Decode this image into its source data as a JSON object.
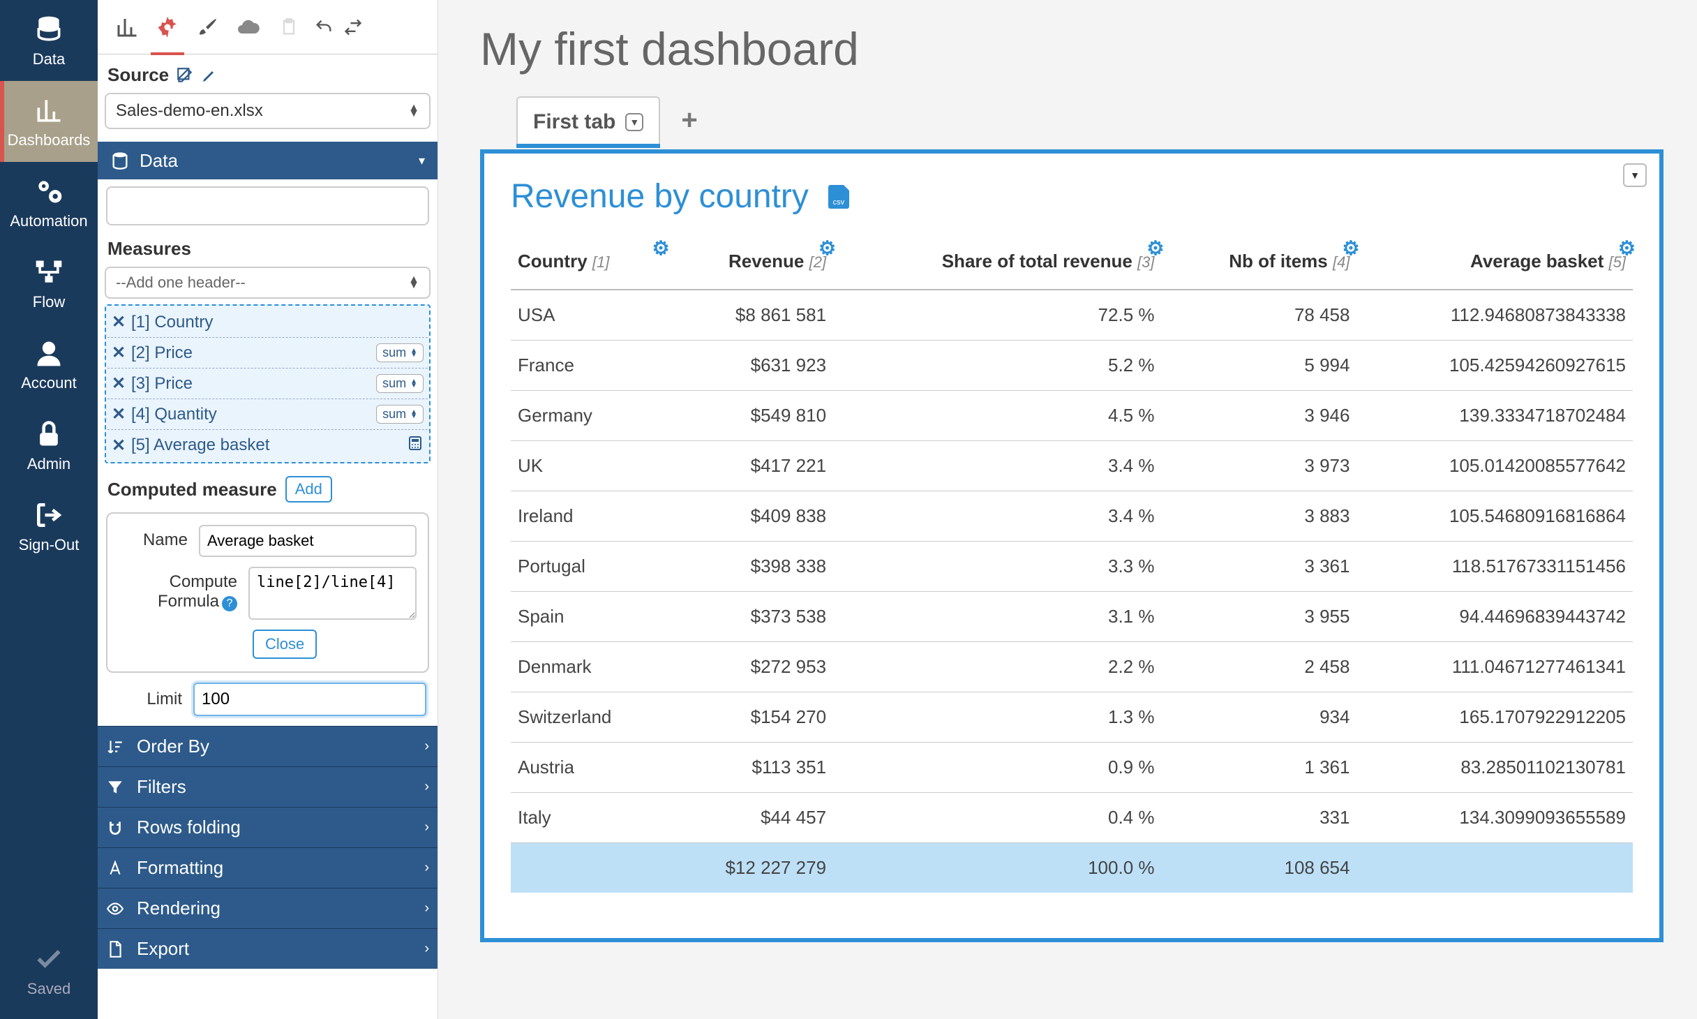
{
  "sidenav": {
    "items": [
      {
        "label": "Data"
      },
      {
        "label": "Dashboards"
      },
      {
        "label": "Automation"
      },
      {
        "label": "Flow"
      },
      {
        "label": "Account"
      },
      {
        "label": "Admin"
      },
      {
        "label": "Sign-Out"
      }
    ],
    "saved": "Saved"
  },
  "config": {
    "source_label": "Source",
    "source_value": "Sales-demo-en.xlsx",
    "data_section": "Data",
    "measures_label": "Measures",
    "add_header_placeholder": "--Add one header--",
    "measures": [
      {
        "label": "[1] Country",
        "agg": null
      },
      {
        "label": "[2] Price",
        "agg": "sum"
      },
      {
        "label": "[3] Price",
        "agg": "sum"
      },
      {
        "label": "[4] Quantity",
        "agg": "sum"
      },
      {
        "label": "[5] Average basket",
        "agg": null,
        "calc": true
      }
    ],
    "computed_label": "Computed measure",
    "add_btn": "Add",
    "name_label": "Name",
    "name_value": "Average basket",
    "formula_label": "Compute Formula",
    "formula_value": "line[2]/line[4]",
    "close_btn": "Close",
    "limit_label": "Limit",
    "limit_value": "100",
    "accordion": [
      {
        "label": "Order By"
      },
      {
        "label": "Filters"
      },
      {
        "label": "Rows folding"
      },
      {
        "label": "Formatting"
      },
      {
        "label": "Rendering"
      },
      {
        "label": "Export"
      }
    ]
  },
  "main": {
    "title": "My first dashboard",
    "tab": "First tab",
    "widget_title": "Revenue by country",
    "csv_label": "csv",
    "columns": [
      {
        "label": "Country",
        "idx": "[1]"
      },
      {
        "label": "Revenue",
        "idx": "[2]"
      },
      {
        "label": "Share of total revenue",
        "idx": "[3]"
      },
      {
        "label": "Nb of items",
        "idx": "[4]"
      },
      {
        "label": "Average basket",
        "idx": "[5]"
      }
    ],
    "rows": [
      {
        "c0": "USA",
        "c1": "$8 861 581",
        "c2": "72.5 %",
        "c3": "78 458",
        "c4": "112.94680873843338"
      },
      {
        "c0": "France",
        "c1": "$631 923",
        "c2": "5.2 %",
        "c3": "5 994",
        "c4": "105.42594260927615"
      },
      {
        "c0": "Germany",
        "c1": "$549 810",
        "c2": "4.5 %",
        "c3": "3 946",
        "c4": "139.3334718702484"
      },
      {
        "c0": "UK",
        "c1": "$417 221",
        "c2": "3.4 %",
        "c3": "3 973",
        "c4": "105.01420085577642"
      },
      {
        "c0": "Ireland",
        "c1": "$409 838",
        "c2": "3.4 %",
        "c3": "3 883",
        "c4": "105.54680916816864"
      },
      {
        "c0": "Portugal",
        "c1": "$398 338",
        "c2": "3.3 %",
        "c3": "3 361",
        "c4": "118.51767331151456"
      },
      {
        "c0": "Spain",
        "c1": "$373 538",
        "c2": "3.1 %",
        "c3": "3 955",
        "c4": "94.44696839443742"
      },
      {
        "c0": "Denmark",
        "c1": "$272 953",
        "c2": "2.2 %",
        "c3": "2 458",
        "c4": "111.04671277461341"
      },
      {
        "c0": "Switzerland",
        "c1": "$154 270",
        "c2": "1.3 %",
        "c3": "934",
        "c4": "165.1707922912205"
      },
      {
        "c0": "Austria",
        "c1": "$113 351",
        "c2": "0.9 %",
        "c3": "1 361",
        "c4": "83.28501102130781"
      },
      {
        "c0": "Italy",
        "c1": "$44 457",
        "c2": "0.4 %",
        "c3": "331",
        "c4": "134.3099093655589"
      }
    ],
    "total": {
      "c0": "",
      "c1": "$12 227 279",
      "c2": "100.0 %",
      "c3": "108 654",
      "c4": ""
    }
  }
}
